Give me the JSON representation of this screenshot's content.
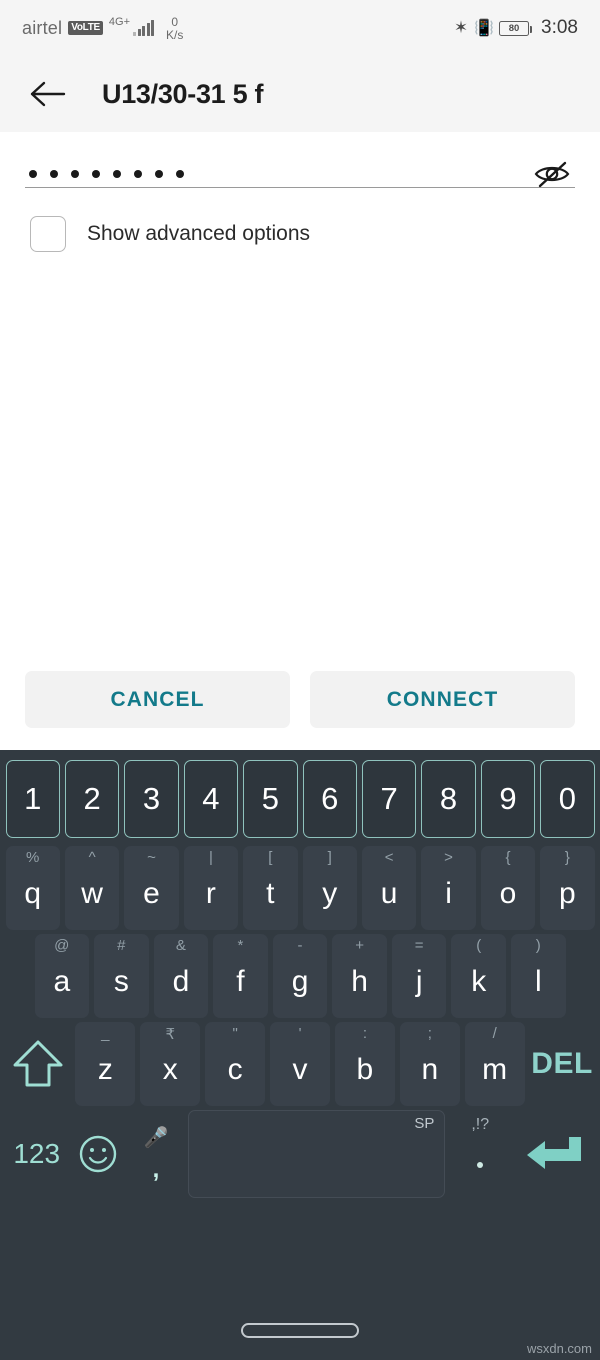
{
  "status_bar": {
    "carrier": "airtel",
    "volte_badge": "VoLTE",
    "network": "4G+",
    "data_speed_value": "0",
    "data_speed_unit": "K/s",
    "bluetooth_icon": "bluetooth-icon",
    "vibrate_icon": "vibrate-icon",
    "battery_level": "80",
    "time": "3:08"
  },
  "app_bar": {
    "back_icon": "back-arrow-icon",
    "title": "U13/30-31 5 f"
  },
  "form": {
    "password_value": "••••••••",
    "password_dot_count": 8,
    "toggle_visibility_icon": "eye-off-icon",
    "advanced_options_label": "Show advanced options",
    "advanced_options_checked": false
  },
  "actions": {
    "cancel_label": "CANCEL",
    "connect_label": "CONNECT",
    "accent_color": "#137a8a",
    "button_bg": "#f2f2f2"
  },
  "keyboard": {
    "accent_color": "#8fd3cb",
    "background": "#323a41",
    "number_row": [
      "1",
      "2",
      "3",
      "4",
      "5",
      "6",
      "7",
      "8",
      "9",
      "0"
    ],
    "row_qwerty": [
      {
        "main": "q",
        "sub": "%"
      },
      {
        "main": "w",
        "sub": "^"
      },
      {
        "main": "e",
        "sub": "~"
      },
      {
        "main": "r",
        "sub": "|"
      },
      {
        "main": "t",
        "sub": "["
      },
      {
        "main": "y",
        "sub": "]"
      },
      {
        "main": "u",
        "sub": "<"
      },
      {
        "main": "i",
        "sub": ">"
      },
      {
        "main": "o",
        "sub": "{"
      },
      {
        "main": "p",
        "sub": "}"
      }
    ],
    "row_asdf": [
      {
        "main": "a",
        "sub": "@"
      },
      {
        "main": "s",
        "sub": "#"
      },
      {
        "main": "d",
        "sub": "&"
      },
      {
        "main": "f",
        "sub": "*"
      },
      {
        "main": "g",
        "sub": "-"
      },
      {
        "main": "h",
        "sub": "+"
      },
      {
        "main": "j",
        "sub": "="
      },
      {
        "main": "k",
        "sub": "("
      },
      {
        "main": "l",
        "sub": ")"
      }
    ],
    "row_zxcv": [
      {
        "main": "z",
        "sub": "_"
      },
      {
        "main": "x",
        "sub": "₹"
      },
      {
        "main": "c",
        "sub": "\""
      },
      {
        "main": "v",
        "sub": "'"
      },
      {
        "main": "b",
        "sub": ":"
      },
      {
        "main": "n",
        "sub": ";"
      },
      {
        "main": "m",
        "sub": "/"
      }
    ],
    "shift_icon": "shift-arrow-icon",
    "delete_label": "DEL",
    "numeric_mode_label": "123",
    "emoji_icon": "emoji-smiley-icon",
    "mic_icon": "microphone-icon",
    "comma_label": ",",
    "space_label": "SP",
    "period_sub_label": ",!?",
    "period_label": ".",
    "enter_icon": "enter-arrow-icon"
  },
  "footer": {
    "home_indicator": "home-indicator-pill",
    "watermark": "wsxdn.com"
  }
}
